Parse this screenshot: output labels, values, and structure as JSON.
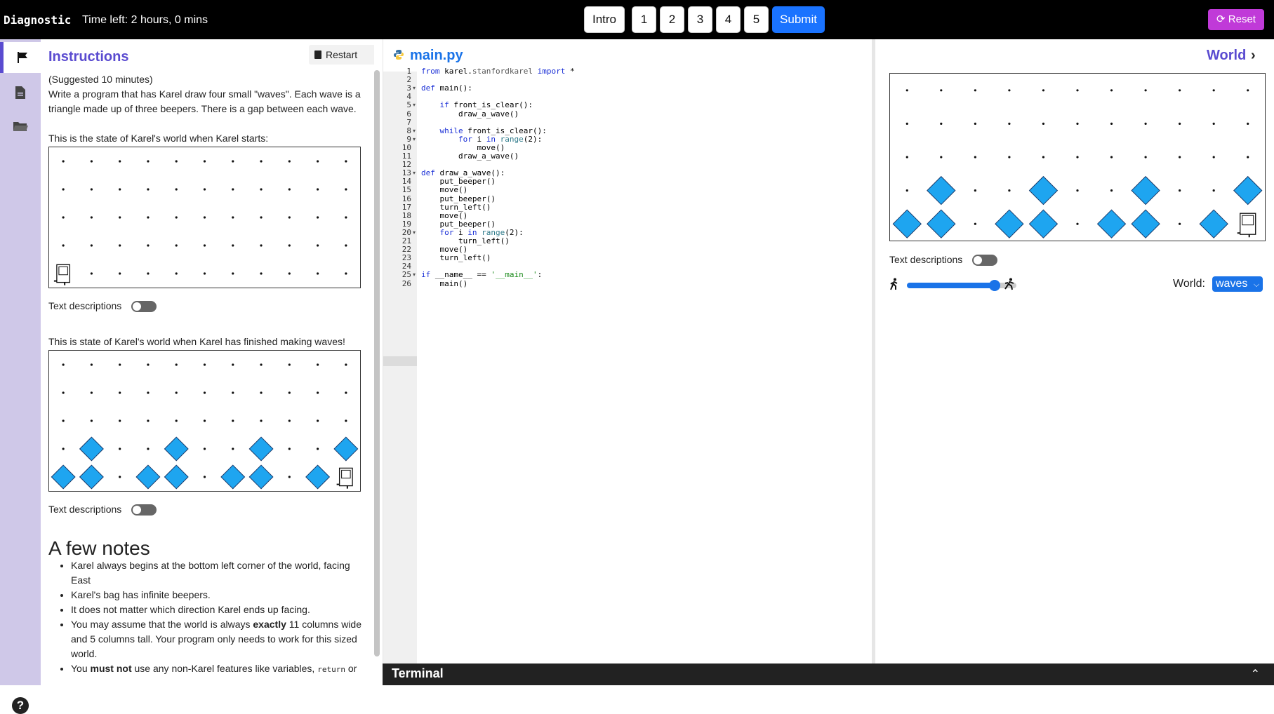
{
  "topbar": {
    "brand": "Diagnostic",
    "time_left": "Time left: 2 hours, 0 mins",
    "nav": [
      "Intro",
      "1",
      "2",
      "3",
      "4",
      "5"
    ],
    "submit": "Submit",
    "reset": "Reset"
  },
  "rail": {
    "icons": [
      "flag-icon",
      "document-icon",
      "folder-icon"
    ],
    "help": "?"
  },
  "instructions": {
    "title": "Instructions",
    "restart": "Restart",
    "suggested": "(Suggested 10 minutes)",
    "description": "Write a program that has Karel draw four small \"waves\". Each wave is a triangle made up of three beepers. There is a gap between each wave.",
    "start_caption": "This is the state of Karel's world when Karel starts:",
    "text_descriptions": "Text descriptions",
    "end_caption": "This is state of Karel's world when Karel has finished making waves!",
    "notes_title": "A few notes",
    "notes": [
      [
        "Karel always begins at the bottom left corner of the world, facing East"
      ],
      [
        "Karel's bag has infinite beepers."
      ],
      [
        "It does not matter which direction Karel ends up facing."
      ],
      [
        "You may assume that the world is always ",
        "exactly",
        " 11 columns wide and 5 columns tall. Your program only needs to work for this sized world."
      ],
      [
        "You ",
        "must not",
        " use any non-Karel features like variables, ",
        "return",
        " or"
      ]
    ]
  },
  "editor": {
    "filename": "main.py",
    "lines": [
      "from karel.stanfordkarel import *",
      "",
      "def main():",
      "",
      "    if front_is_clear():",
      "        draw_a_wave()",
      "",
      "    while front_is_clear():",
      "        for i in range(2):",
      "            move()",
      "        draw_a_wave()",
      "",
      "def draw_a_wave():",
      "    put_beeper()",
      "    move()",
      "    put_beeper()",
      "    turn_left()",
      "    move()",
      "    put_beeper()",
      "    for i in range(2):",
      "        turn_left()",
      "    move()",
      "    turn_left()",
      "",
      "if __name__ == '__main__':",
      "    main()"
    ],
    "folds": [
      3,
      5,
      8,
      9,
      13,
      20,
      25
    ]
  },
  "world_panel": {
    "title": "World",
    "text_descriptions": "Text descriptions",
    "world_label": "World:",
    "world_value": "waves"
  },
  "terminal": {
    "title": "Terminal"
  },
  "worlds": {
    "cols": 11,
    "rows": 5,
    "start": {
      "beepers": [],
      "karel": [
        1,
        1
      ]
    },
    "finished": {
      "beepers": [
        [
          1,
          1
        ],
        [
          2,
          1
        ],
        [
          2,
          2
        ],
        [
          4,
          1
        ],
        [
          5,
          1
        ],
        [
          5,
          2
        ],
        [
          7,
          1
        ],
        [
          8,
          1
        ],
        [
          8,
          2
        ],
        [
          10,
          1
        ],
        [
          11,
          2
        ]
      ],
      "karel": [
        11,
        1
      ]
    },
    "current": {
      "beepers": [
        [
          1,
          1
        ],
        [
          2,
          1
        ],
        [
          2,
          2
        ],
        [
          4,
          1
        ],
        [
          5,
          1
        ],
        [
          5,
          2
        ],
        [
          7,
          1
        ],
        [
          8,
          1
        ],
        [
          8,
          2
        ],
        [
          10,
          1
        ],
        [
          11,
          2
        ]
      ],
      "karel": [
        11,
        1
      ]
    }
  },
  "colors": {
    "accent": "#5a4bd0",
    "beeper": "#1ea5f0",
    "link": "#1a73e8",
    "reset": "#c03ad8"
  }
}
